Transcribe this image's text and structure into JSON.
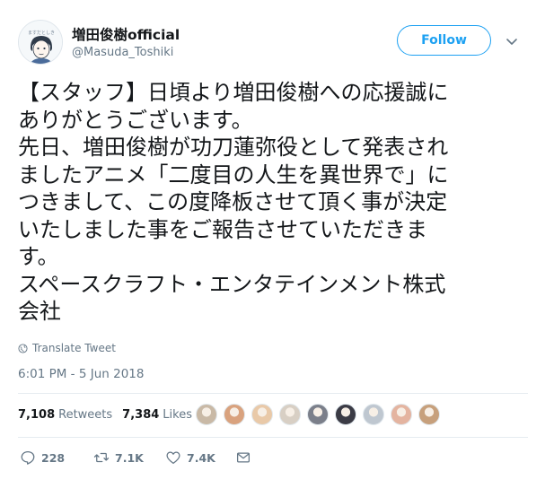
{
  "author": {
    "display_name": "増田俊樹official",
    "handle": "@Masuda_Toshiki"
  },
  "follow_label": "Follow",
  "tweet": {
    "lines": [
      "【スタッフ】日頃より増田俊樹への応援誠に",
      "ありがとうございます。",
      "先日、増田俊樹が功刀蓮弥役として発表され",
      "ましたアニメ「二度目の人生を異世界で」に",
      "つきまして、この度降板させて頂く事が決定",
      "いたしました事をご報告させていただきま",
      "す。",
      "スペースクラフト・エンタテインメント株式",
      "会社"
    ]
  },
  "translate_label": "Translate Tweet",
  "timestamp": "6:01 PM - 5 Jun 2018",
  "stats": {
    "retweets_count": "7,108",
    "retweets_label": "Retweets",
    "likes_count": "7,384",
    "likes_label": "Likes"
  },
  "likers": [
    {
      "icon": "liker-avatar-1",
      "color": "#c9b9a6"
    },
    {
      "icon": "liker-avatar-2",
      "color": "#d9a27e"
    },
    {
      "icon": "liker-avatar-3",
      "color": "#e9c9a8"
    },
    {
      "icon": "liker-avatar-4",
      "color": "#d8cfc4"
    },
    {
      "icon": "liker-avatar-5",
      "color": "#7b7f8a"
    },
    {
      "icon": "liker-avatar-6",
      "color": "#3b3b45"
    },
    {
      "icon": "liker-avatar-7",
      "color": "#bfc7d0"
    },
    {
      "icon": "liker-avatar-8",
      "color": "#e4b4a0"
    },
    {
      "icon": "liker-avatar-9",
      "color": "#c7a07c"
    }
  ],
  "actions": {
    "reply_count": "228",
    "retweet_count": "7.1K",
    "like_count": "7.4K"
  },
  "colors": {
    "accent": "#1da1f2",
    "secondary_text": "#657786",
    "primary_text": "#14171a"
  }
}
